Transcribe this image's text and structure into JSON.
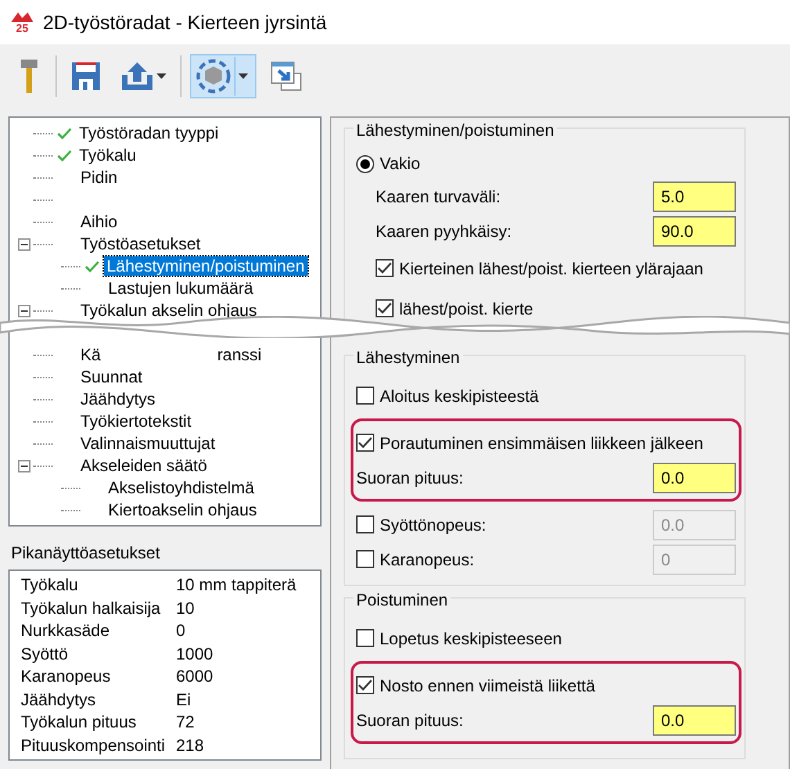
{
  "window": {
    "logo_text": "25",
    "title": "2D-työstöradat - Kierteen jyrsintä"
  },
  "toolbar": {
    "buttons": [
      {
        "kind": "tool",
        "selected": false,
        "dropdown": false
      },
      {
        "kind": "save",
        "selected": false,
        "dropdown": false
      },
      {
        "kind": "export",
        "selected": false,
        "dropdown": true
      },
      {
        "kind": "view",
        "selected": true,
        "dropdown": true
      },
      {
        "kind": "window",
        "selected": false,
        "dropdown": false
      }
    ]
  },
  "tree": {
    "items": [
      {
        "label": "Työstöradan tyyppi",
        "checked": true,
        "selected": false
      },
      {
        "label": "Työkalu",
        "checked": true,
        "selected": false
      },
      {
        "label": "Pidin",
        "checked": false,
        "selected": false
      },
      {
        "kind": "blank"
      },
      {
        "label": "Aihio",
        "checked": false,
        "selected": false
      },
      {
        "label": "Työstöasetukset",
        "checked": false,
        "selected": false,
        "expanded": true,
        "children": [
          {
            "label": "Lähestyminen/poistuminen",
            "checked": true,
            "selected": true
          },
          {
            "label": "Lastujen lukumäärä",
            "checked": false,
            "selected": false
          }
        ]
      },
      {
        "label": "Työkalun akselin ohjaus",
        "checked": false,
        "selected": false,
        "expanded": true
      },
      {
        "kind": "tear"
      },
      {
        "fragments": [
          "Kä",
          "ranssi"
        ]
      },
      {
        "label": "Suunnat",
        "checked": false,
        "selected": false
      },
      {
        "label": "Jäähdytys",
        "checked": false,
        "selected": false
      },
      {
        "label": "Työkiertotekstit",
        "checked": false,
        "selected": false
      },
      {
        "label": "Valinnaismuuttujat",
        "checked": false,
        "selected": false
      },
      {
        "label": "Akseleiden säätö",
        "checked": false,
        "selected": false,
        "expanded": true,
        "children": [
          {
            "label": "Akselistoyhdistelmä",
            "checked": false,
            "selected": false
          },
          {
            "label": "Kiertoakselin ohjaus",
            "checked": false,
            "selected": false
          }
        ]
      }
    ]
  },
  "quick_view": {
    "title": "Pikanäyttöasetukset",
    "rows": [
      [
        "Työkalu",
        "10 mm tappiterä"
      ],
      [
        "Työkalun halkaisija",
        "10"
      ],
      [
        "Nurkkasäde",
        "0"
      ],
      [
        "Syöttö",
        "1000"
      ],
      [
        "Karanopeus",
        "6000"
      ],
      [
        "Jäähdytys",
        "Ei"
      ],
      [
        "Työkalun pituus",
        "72"
      ],
      [
        "Pituuskompensointi",
        "218"
      ]
    ]
  },
  "groups": [
    {
      "title": "Lähestyminen/poistuminen",
      "cut": true,
      "items": [
        {
          "kind": "radio",
          "label": "Vakio",
          "selected": true
        },
        {
          "kind": "field",
          "label": "Kaaren turvaväli:",
          "value": "5.0"
        },
        {
          "kind": "field",
          "label": "Kaaren pyyhkäisy:",
          "value": "90.0"
        },
        {
          "kind": "checkbox",
          "label": "Kierteinen lähest/poist. kierteen ylärajaan",
          "checked": true
        },
        {
          "kind": "checkbox",
          "label": "lähest/poist. kierte",
          "checked": true
        }
      ]
    },
    {
      "title": "Lähestyminen",
      "items": [
        {
          "kind": "checkbox",
          "label": "Aloitus keskipisteestä",
          "checked": false
        },
        {
          "kind": "highlight",
          "items": [
            {
              "kind": "checkbox",
              "label": "Porautuminen ensimmäisen liikkeen jälkeen",
              "checked": true
            },
            {
              "kind": "field",
              "label": "Suoran pituus:",
              "value": "0.0"
            }
          ]
        },
        {
          "kind": "checkfield",
          "label": "Syöttönopeus:",
          "checked": false,
          "value": "0.0",
          "disabled": true
        },
        {
          "kind": "checkfield",
          "label": "Karanopeus:",
          "checked": false,
          "value": "0",
          "disabled": true
        }
      ]
    },
    {
      "title": "Poistuminen",
      "items": [
        {
          "kind": "checkbox",
          "label": "Lopetus keskipisteeseen",
          "checked": false
        },
        {
          "kind": "highlight",
          "items": [
            {
              "kind": "checkbox",
              "label": "Nosto ennen viimeistä liikettä",
              "checked": true
            },
            {
              "kind": "field",
              "label": "Suoran pituus:",
              "value": "0.0"
            }
          ]
        }
      ]
    }
  ]
}
